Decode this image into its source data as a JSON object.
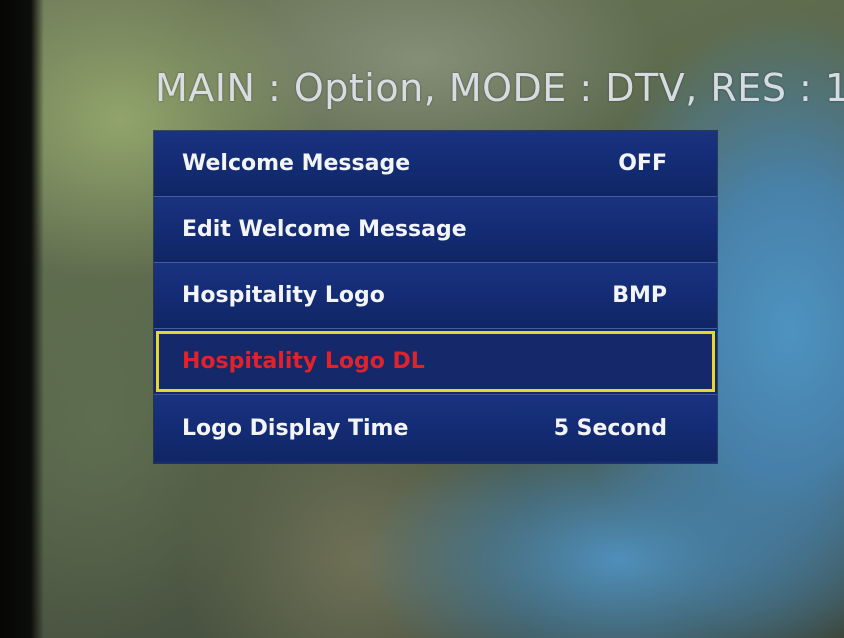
{
  "header": {
    "status_line": "MAIN : Option, MODE : DTV, RES : 1"
  },
  "menu": {
    "items": [
      {
        "label": "Welcome Message",
        "value": "OFF"
      },
      {
        "label": "Edit Welcome Message",
        "value": ""
      },
      {
        "label": "Hospitality Logo",
        "value": "BMP"
      },
      {
        "label": "Hospitality Logo DL",
        "value": ""
      },
      {
        "label": "Logo Display Time",
        "value": "5 Second"
      }
    ],
    "selected_index": 3
  },
  "colors": {
    "menu_background": "#142c73",
    "selection_border": "#e4d82c",
    "selected_text": "#e0232a",
    "text": "#f2f4fa"
  }
}
